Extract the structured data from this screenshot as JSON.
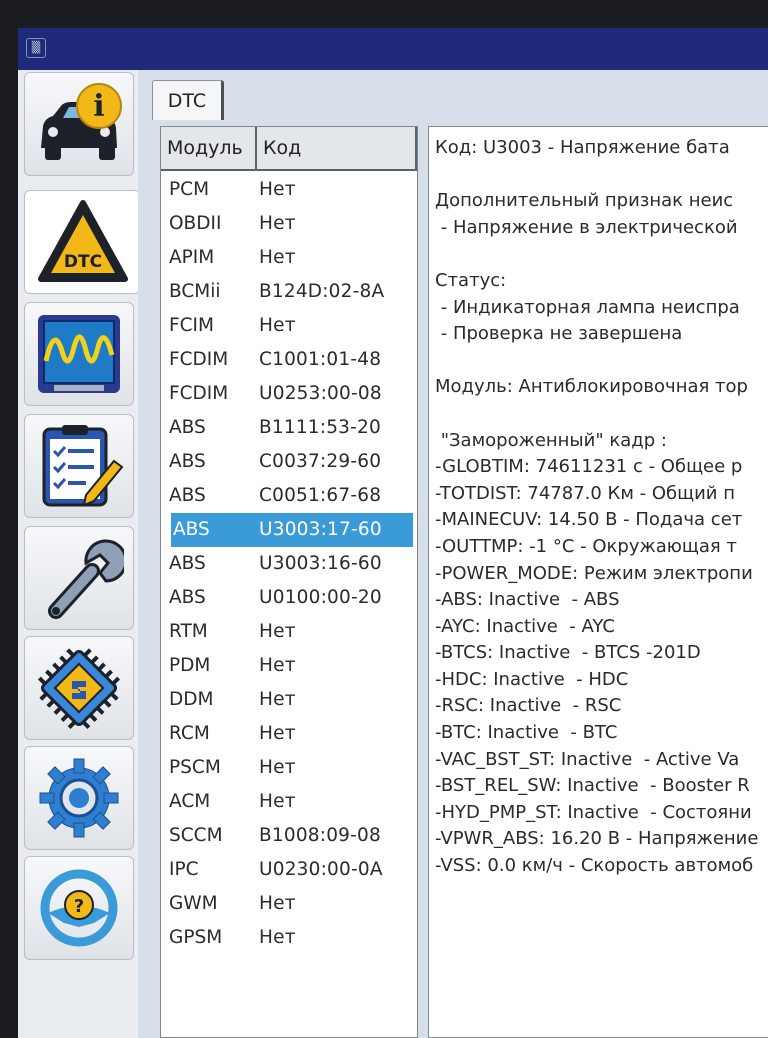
{
  "title_icon": "▒",
  "tabs": [
    {
      "label": "DTC"
    }
  ],
  "list": {
    "headers": {
      "module": "Модуль",
      "code": "Код"
    },
    "rows": [
      {
        "module": "PCM",
        "code": "Нет"
      },
      {
        "module": "OBDII",
        "code": "Нет"
      },
      {
        "module": "APIM",
        "code": "Нет"
      },
      {
        "module": "BCMii",
        "code": "B124D:02-8A"
      },
      {
        "module": "FCIM",
        "code": "Нет"
      },
      {
        "module": "FCDIM",
        "code": "C1001:01-48"
      },
      {
        "module": "FCDIM",
        "code": "U0253:00-08"
      },
      {
        "module": "ABS",
        "code": "B1111:53-20"
      },
      {
        "module": "ABS",
        "code": "C0037:29-60"
      },
      {
        "module": "ABS",
        "code": "C0051:67-68"
      },
      {
        "module": "ABS",
        "code": "U3003:17-60",
        "selected": true
      },
      {
        "module": "ABS",
        "code": "U3003:16-60"
      },
      {
        "module": "ABS",
        "code": "U0100:00-20"
      },
      {
        "module": "RTM",
        "code": "Нет"
      },
      {
        "module": "PDM",
        "code": "Нет"
      },
      {
        "module": "DDM",
        "code": "Нет"
      },
      {
        "module": "RCM",
        "code": "Нет"
      },
      {
        "module": "PSCM",
        "code": "Нет"
      },
      {
        "module": "ACM",
        "code": "Нет"
      },
      {
        "module": "SCCM",
        "code": "B1008:09-08"
      },
      {
        "module": "IPC",
        "code": "U0230:00-0A"
      },
      {
        "module": "GWM",
        "code": "Нет"
      },
      {
        "module": "GPSM",
        "code": "Нет"
      }
    ]
  },
  "detail": {
    "lines": [
      "Код: U3003 - Напряжение бата",
      "",
      "Дополнительный признак неис",
      " - Напряжение в электрической",
      "",
      "Статус:",
      " - Индикаторная лампа неиспра",
      " - Проверка не завершена",
      "",
      "Модуль: Антиблокировочная тор",
      "",
      " \"Замороженный\" кадр :",
      "-GLOBTIM: 74611231 с - Общее р",
      "-TOTDIST: 74787.0 Км - Общий п",
      "-MAINECUV: 14.50 В - Подача сет",
      "-OUTTMP: -1 °С - Окружающая т",
      "-POWER_MODE: Режим электропи",
      "-ABS: Inactive  - ABS",
      "-AYC: Inactive  - AYC",
      "-BTCS: Inactive  - BTCS -201D",
      "-HDC: Inactive  - HDC",
      "-RSC: Inactive  - RSC",
      "-BTC: Inactive  - BTC",
      "-VAC_BST_ST: Inactive  - Active Va",
      "-BST_REL_SW: Inactive  - Booster R",
      "-HYD_PMP_ST: Inactive  - Состояни",
      "-VPWR_ABS: 16.20 В - Напряжение",
      "-VSS: 0.0 км/ч - Скорость автомоб"
    ]
  },
  "nav": [
    {
      "id": "vehicle-info",
      "icon": "car-info-icon",
      "badge": "i"
    },
    {
      "id": "dtc",
      "icon": "dtc-warning-icon",
      "badge": "DTC"
    },
    {
      "id": "oscilloscope",
      "icon": "oscilloscope-icon"
    },
    {
      "id": "checklist",
      "icon": "checklist-icon"
    },
    {
      "id": "service",
      "icon": "wrench-icon"
    },
    {
      "id": "module-programming",
      "icon": "chip-icon"
    },
    {
      "id": "settings",
      "icon": "gear-icon"
    },
    {
      "id": "help",
      "icon": "steering-help-icon",
      "badge": "?"
    }
  ],
  "colors": {
    "titlebar": "#1f2a7a",
    "selection": "#3a9bd8",
    "badge_yellow": "#f2b817"
  }
}
